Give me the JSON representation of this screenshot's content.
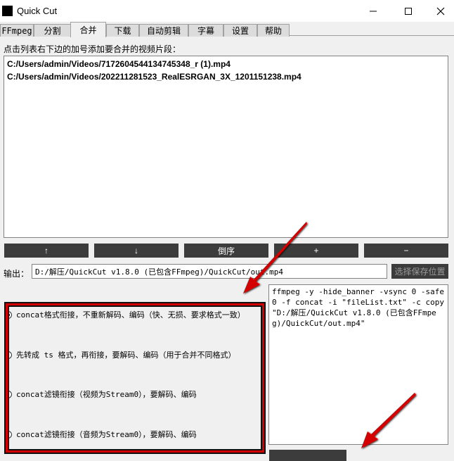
{
  "window": {
    "title": "Quick Cut",
    "minimize_label": "minimize",
    "maximize_label": "maximize",
    "close_label": "close"
  },
  "tabs": [
    {
      "label": "FFmpeg",
      "active": false
    },
    {
      "label": "分割",
      "active": false
    },
    {
      "label": "合并",
      "active": true
    },
    {
      "label": "下载",
      "active": false
    },
    {
      "label": "自动剪辑",
      "active": false
    },
    {
      "label": "字幕",
      "active": false
    },
    {
      "label": "设置",
      "active": false
    },
    {
      "label": "帮助",
      "active": false
    }
  ],
  "merge": {
    "hint": "点击列表右下边的加号添加要合并的视频片段：",
    "files": [
      "C:/Users/admin/Videos/7172604544134745348_r (1).mp4",
      "C:/Users/admin/Videos/202211281523_RealESRGAN_3X_1201151238.mp4"
    ],
    "controls": {
      "up": "↑",
      "down": "↓",
      "reverse": "倒序",
      "add": "+",
      "remove": "−"
    },
    "output_label": "输出：",
    "output_value": "D:/解压/QuickCut v1.8.0 (已包含FFmpeg)/QuickCut/out.mp4",
    "save_location_button": "选择保存位置",
    "options": [
      {
        "label": "concat格式衔接，不重新解码、编码（快、无损、要求格式一致）",
        "checked": true
      },
      {
        "label": "先转成 ts 格式，再衔接，要解码、编码（用于合并不同格式）",
        "checked": false
      },
      {
        "label": "concat滤镜衔接（视频为Stream0），要解码、编码",
        "checked": false
      },
      {
        "label": "concat滤镜衔接（音频为Stream0），要解码、编码",
        "checked": false
      }
    ],
    "command": "ffmpeg -y -hide_banner -vsync 0 -safe 0 -f concat -i \"fileList.txt\" -c copy \"D:/解压/QuickCut v1.8.0 (已包含FFmpeg)/QuickCut/out.mp4\""
  },
  "colors": {
    "button_bg": "#3c3c3c",
    "highlight": "#d40000",
    "arrow": "#d40000"
  }
}
